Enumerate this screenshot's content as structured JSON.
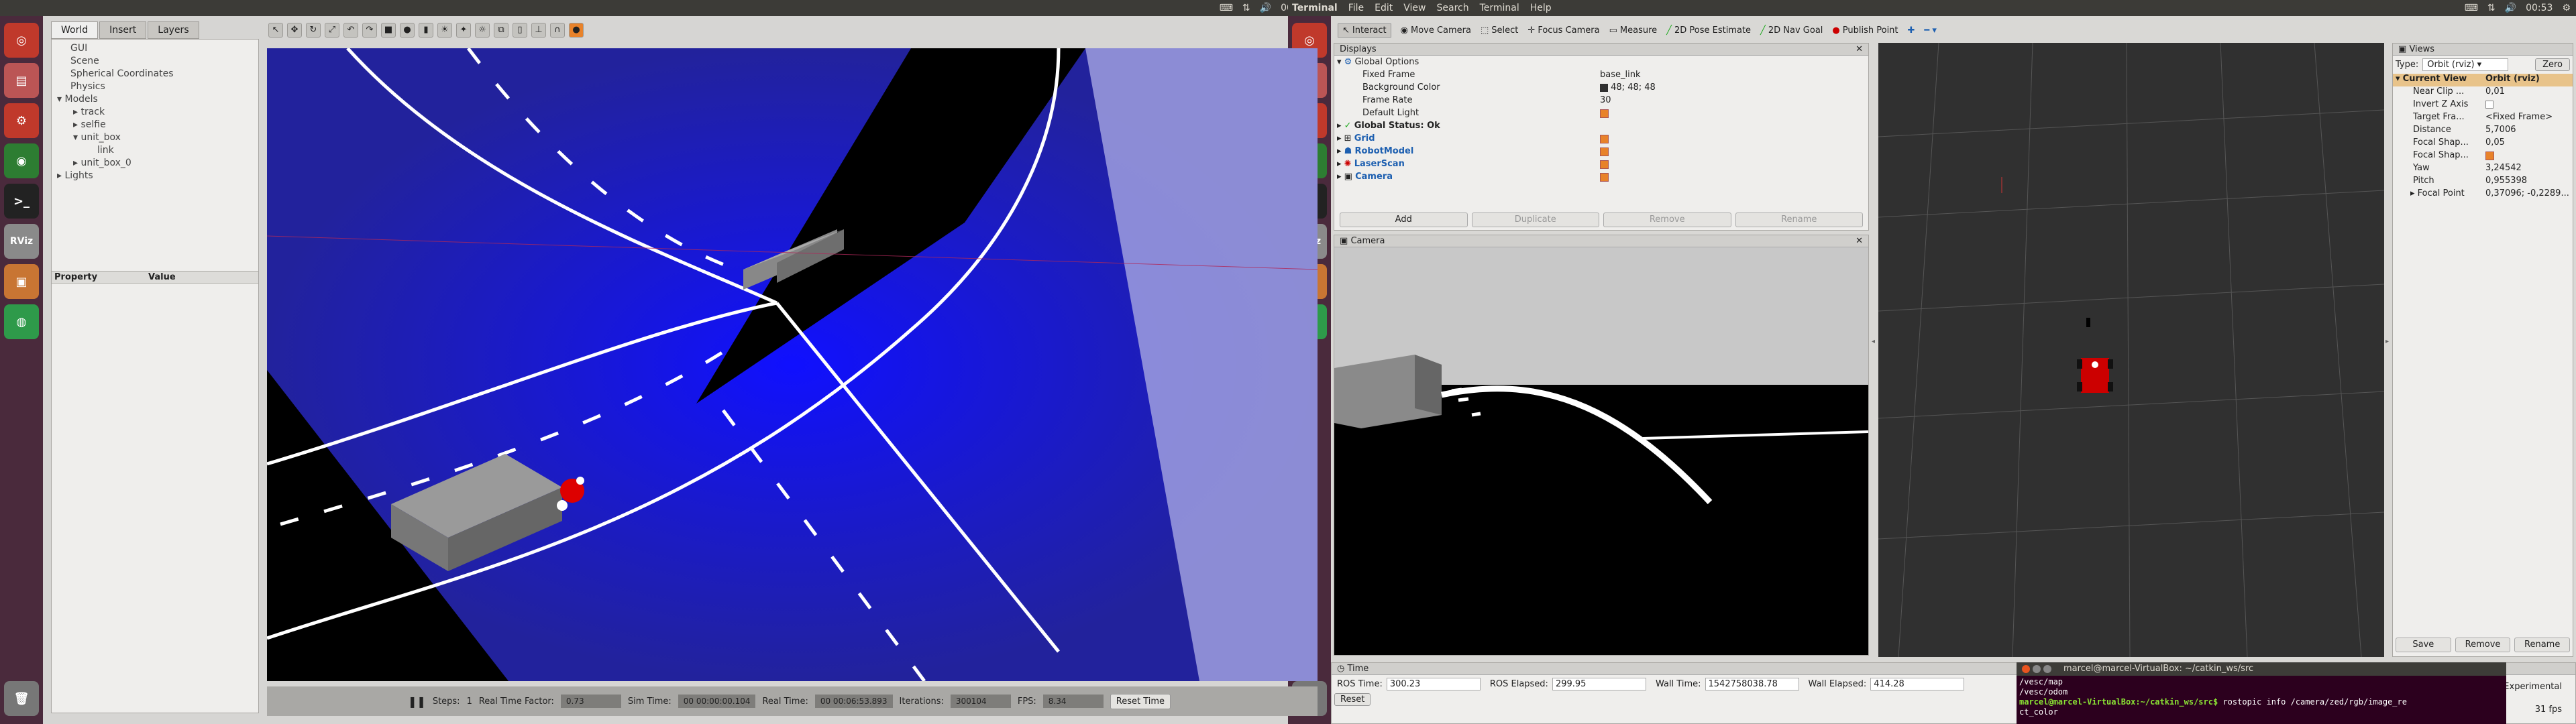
{
  "left_topbar": {
    "time": "00:53"
  },
  "right_topbar": {
    "app": "Terminal",
    "menus": [
      "Terminal",
      "File",
      "Edit",
      "View",
      "Search",
      "Terminal",
      "Help"
    ],
    "time": "00:53"
  },
  "launcher_icons": [
    "ubuntu-icon",
    "files-icon",
    "settings-icon",
    "chrome-icon",
    "terminal-icon",
    "rviz-icon",
    "box-icon",
    "gazebo-icon",
    "trash-icon"
  ],
  "launcher_rviz_label": "RViz",
  "gazebo": {
    "tabs": [
      "World",
      "Insert",
      "Layers"
    ],
    "tree": [
      "GUI",
      "Scene",
      "Spherical Coordinates",
      "Physics",
      "Models",
      "track",
      "selfie",
      "unit_box",
      "link",
      "unit_box_0",
      "Lights"
    ],
    "prop_headers": [
      "Property",
      "Value"
    ],
    "bottom": {
      "steps_label": "Steps:",
      "steps_value": "1",
      "rtf_label": "Real Time Factor:",
      "rtf_value": "0.73",
      "simtime_label": "Sim Time:",
      "simtime_value": "00 00:00:00.104",
      "realtime_label": "Real Time:",
      "realtime_value": "00 00:06:53.893",
      "iter_label": "Iterations:",
      "iter_value": "300104",
      "fps_label": "FPS:",
      "fps_value": "8.34",
      "reset_label": "Reset Time"
    }
  },
  "rviz": {
    "toolbar": [
      "Interact",
      "Move Camera",
      "Select",
      "Focus Camera",
      "Measure",
      "2D Pose Estimate",
      "2D Nav Goal",
      "Publish Point"
    ],
    "displays_title": "Displays",
    "global_options": "Global Options",
    "options": [
      {
        "k": "Fixed Frame",
        "v": "base_link"
      },
      {
        "k": "Background Color",
        "v": "48; 48; 48"
      },
      {
        "k": "Frame Rate",
        "v": "30"
      },
      {
        "k": "Default Light",
        "v": ""
      }
    ],
    "status": "Global Status: Ok",
    "displays": [
      "Grid",
      "RobotModel",
      "LaserScan",
      "Camera"
    ],
    "buttons": [
      "Add",
      "Duplicate",
      "Remove",
      "Rename"
    ],
    "camera_title": "Camera",
    "time_title": "Time",
    "ros_time_label": "ROS Time:",
    "ros_time": "300.23",
    "ros_elapsed_label": "ROS Elapsed:",
    "ros_elapsed": "299.95",
    "wall_time_label": "Wall Time:",
    "wall_time": "1542758038.78",
    "wall_elapsed_label": "Wall Elapsed:",
    "wall_elapsed": "414.28",
    "reset": "Reset",
    "views_title": "Views",
    "views_type_label": "Type:",
    "views_type": "Orbit (rviz)",
    "zero": "Zero",
    "current_view": "Current View",
    "current_view_value": "Orbit (rviz)",
    "view_props": [
      {
        "k": "Near Clip ...",
        "v": "0,01"
      },
      {
        "k": "Invert Z Axis",
        "v": ""
      },
      {
        "k": "Target Fra...",
        "v": "<Fixed Frame>"
      },
      {
        "k": "Distance",
        "v": "5,7006"
      },
      {
        "k": "Focal Shap...",
        "v": "0,05"
      },
      {
        "k": "Focal Shap...",
        "v": ""
      },
      {
        "k": "Yaw",
        "v": "3,24542"
      },
      {
        "k": "Pitch",
        "v": "0,955398"
      },
      {
        "k": "Focal Point",
        "v": "0,37096; -0,2289..."
      }
    ],
    "views_buttons": [
      "Save",
      "Remove",
      "Rename"
    ],
    "experimental": "Experimental",
    "fps": "31 fps"
  },
  "terminal": {
    "title": "marcel@marcel-VirtualBox: ~/catkin_ws/src",
    "lines": [
      "/vesc/map",
      "/vesc/odom"
    ],
    "prompt_user": "marcel@marcel-VirtualBox:~/catkin_ws/src$",
    "command": " rostopic info /camera/zed/rgb/image_re",
    "wrap": "ct_color"
  },
  "colors": {
    "accent": "#e8822a",
    "rviz_bg": "#303030",
    "terminal_bg": "#2c001e"
  }
}
